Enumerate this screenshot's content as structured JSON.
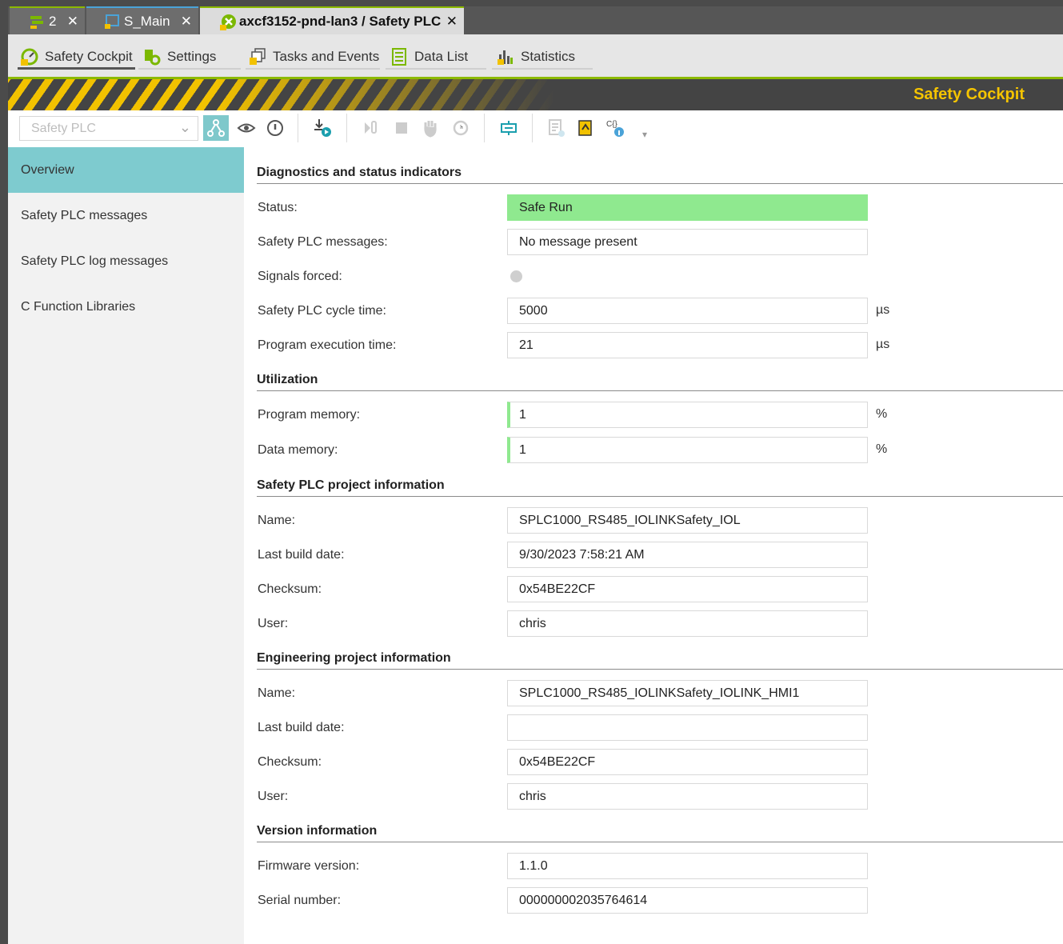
{
  "doc_tabs": [
    {
      "label": "2",
      "close": "✕"
    },
    {
      "label": "S_Main",
      "close": "✕"
    },
    {
      "label": "axcf3152-pnd-lan3 / Safety PLC",
      "close": "✕"
    }
  ],
  "editor_tabs": [
    {
      "label": "Safety Cockpit"
    },
    {
      "label": "Settings"
    },
    {
      "label": "Tasks and Events"
    },
    {
      "label": "Data List"
    },
    {
      "label": "Statistics"
    }
  ],
  "header": {
    "title": "Safety Cockpit"
  },
  "toolbar": {
    "plc_select_value": "Safety PLC"
  },
  "sidenav": [
    {
      "label": "Overview"
    },
    {
      "label": "Safety PLC messages"
    },
    {
      "label": "Safety PLC log messages"
    },
    {
      "label": "C Function Libraries"
    }
  ],
  "diagnostics": {
    "title": "Diagnostics and status indicators",
    "status_label": "Status:",
    "status_value": "Safe Run",
    "messages_label": "Safety PLC messages:",
    "messages_value": "No message present",
    "forced_label": "Signals forced:",
    "cycle_label": "Safety PLC cycle time:",
    "cycle_value": "5000",
    "cycle_unit": "µs",
    "exec_label": "Program execution time:",
    "exec_value": "21",
    "exec_unit": "µs"
  },
  "utilization": {
    "title": "Utilization",
    "program_label": "Program memory:",
    "program_value": "1",
    "program_unit": "%",
    "data_label": "Data memory:",
    "data_value": "1",
    "data_unit": "%"
  },
  "plc_project": {
    "title": "Safety PLC project information",
    "name_label": "Name:",
    "name_value": "SPLC1000_RS485_IOLINKSafety_IOL",
    "build_label": "Last build date:",
    "build_value": "9/30/2023 7:58:21 AM",
    "checksum_label": "Checksum:",
    "checksum_value": "0x54BE22CF",
    "user_label": "User:",
    "user_value": "chris"
  },
  "eng_project": {
    "title": "Engineering project information",
    "name_label": "Name:",
    "name_value": "SPLC1000_RS485_IOLINKSafety_IOLINK_HMI1",
    "build_label": "Last build date:",
    "build_value": "",
    "checksum_label": "Checksum:",
    "checksum_value": "0x54BE22CF",
    "user_label": "User:",
    "user_value": "chris"
  },
  "version": {
    "title": "Version information",
    "firmware_label": "Firmware version:",
    "firmware_value": "1.1.0",
    "serial_label": "Serial number:",
    "serial_value": "000000002035764614"
  }
}
